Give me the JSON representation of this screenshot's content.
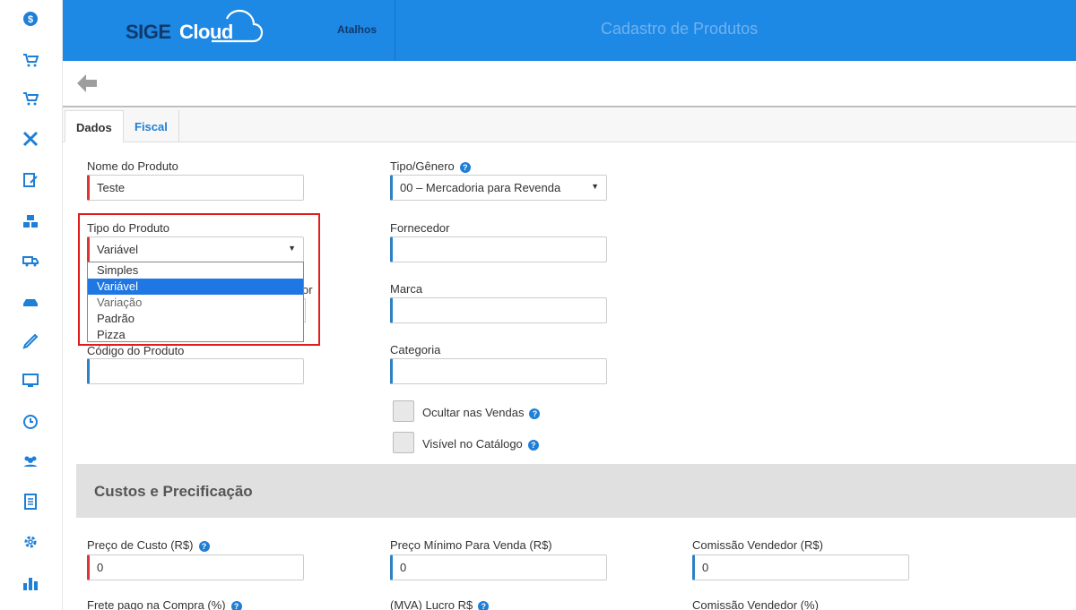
{
  "header": {
    "logo_part1": "SIGE",
    "logo_part2": "Cloud",
    "shortcuts_label": "Atalhos",
    "page_title": "Cadastro de Produtos"
  },
  "tabs": [
    {
      "label": "Dados",
      "active": true
    },
    {
      "label": "Fiscal",
      "active": false
    }
  ],
  "form": {
    "nome_produto": {
      "label": "Nome do Produto",
      "value": "Teste"
    },
    "tipo_genero": {
      "label": "Tipo/Gênero",
      "value": "00 – Mercadoria para Revenda"
    },
    "tipo_produto": {
      "label": "Tipo do Produto",
      "value": "Variável",
      "options": [
        "Simples",
        "Variável",
        "Variação",
        "Padrão",
        "Pizza"
      ]
    },
    "fornecedor": {
      "label": "Fornecedor",
      "value": ""
    },
    "hidden_label_tail": "or",
    "marca": {
      "label": "Marca",
      "value": ""
    },
    "codigo_produto": {
      "label": "Código do Produto",
      "value": ""
    },
    "categoria": {
      "label": "Categoria",
      "value": ""
    },
    "ocultar_vendas": {
      "label": "Ocultar nas Vendas",
      "checked": false
    },
    "visivel_catalogo": {
      "label": "Visível no Catálogo",
      "checked": false
    }
  },
  "pricing": {
    "section_title": "Custos e Precificação",
    "preco_custo": {
      "label": "Preço de Custo (R$)",
      "value": "0"
    },
    "preco_minimo": {
      "label": "Preço Mínimo Para Venda (R$)",
      "value": "0"
    },
    "comissao_rs": {
      "label": "Comissão Vendedor (R$)",
      "value": "0"
    },
    "frete_label": "Frete pago na Compra (%)",
    "mva_label": "(MVA) Lucro R$",
    "comissao_pct_label": "Comissão Vendedor (%)"
  },
  "colors": {
    "brand_blue": "#1e88e5",
    "accent_blue": "#1e7fd6",
    "required_red": "#dd3333",
    "highlight_red": "#e21b1b"
  },
  "sidebar_icons": [
    "dollar-icon",
    "cart-icon",
    "cart-check-icon",
    "tools-icon",
    "edit-icon",
    "boxes-icon",
    "truck-icon",
    "car-icon",
    "pencil-icon",
    "monitor-icon",
    "clock-icon",
    "users-icon",
    "document-icon",
    "gear-icon",
    "bar-chart-icon"
  ]
}
